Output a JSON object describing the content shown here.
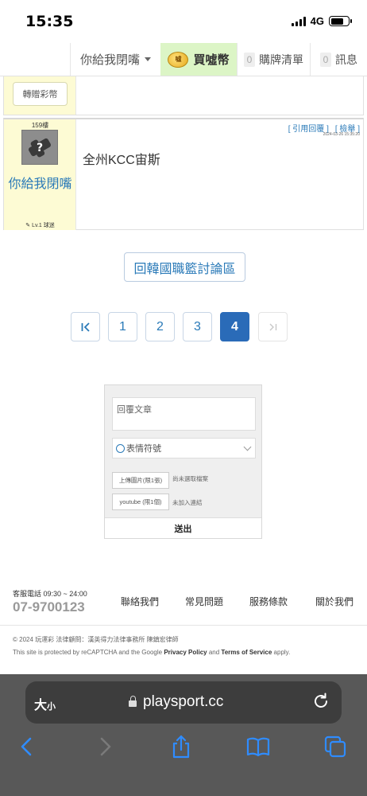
{
  "status_bar": {
    "time": "15:35",
    "network": "4G"
  },
  "topnav": {
    "user_label": "你給我閉嘴",
    "coin_label": "買噓幣",
    "coin_icon_text": "噓",
    "cart_count": "0",
    "cart_label": "購牌清單",
    "msg_count": "0",
    "msg_label": "訊息"
  },
  "post_previous": {
    "gift_label": "轉贈彩幣"
  },
  "post": {
    "floor": "159樓",
    "name": "你給我閉嘴",
    "level": "Lv.1 球迷",
    "quote_label": "[ 引用回覆 ]",
    "report_label": "[ 檢舉 ]",
    "date": "2024-03-26 15:35:20",
    "content": "全州KCC宙斯"
  },
  "back_button": "回韓國職籃討論區",
  "pagination": {
    "first_label": "|<",
    "pages": [
      "1",
      "2",
      "3",
      "4"
    ],
    "active_page": "4",
    "last_label": ">|"
  },
  "reply": {
    "placeholder": "回覆文章",
    "emoji_label": "表情符號",
    "upload_image_label": "上傳圖片(限1張)",
    "upload_image_status": "尚未選取檔案",
    "youtube_label": "youtube (限1個)",
    "youtube_status": "未加入連結",
    "submit_label": "送出"
  },
  "footer": {
    "hotline_label": "客服電話 09:30 ~ 24:00",
    "hotline_number": "07-9700123",
    "links": [
      "聯絡我們",
      "常見問題",
      "服務條款",
      "關於我們"
    ],
    "copyright": "© 2024 玩運彩 法律顧問：漢英得力法律事務所 陳鎮宏律師",
    "recaptcha_prefix": "This site is protected by reCAPTCHA and the Google",
    "privacy_policy": "Privacy Policy",
    "and": "and",
    "terms": "Terms of Service",
    "apply": "apply."
  },
  "browser": {
    "text_size_big": "大",
    "text_size_small": "小",
    "url": "playsport.cc"
  },
  "colors": {
    "accent_blue": "#2a7ab8",
    "active_page": "#2a6bb8",
    "user_side_bg": "#fdfbd4",
    "coin_tab_bg": "#dcf5c6"
  }
}
